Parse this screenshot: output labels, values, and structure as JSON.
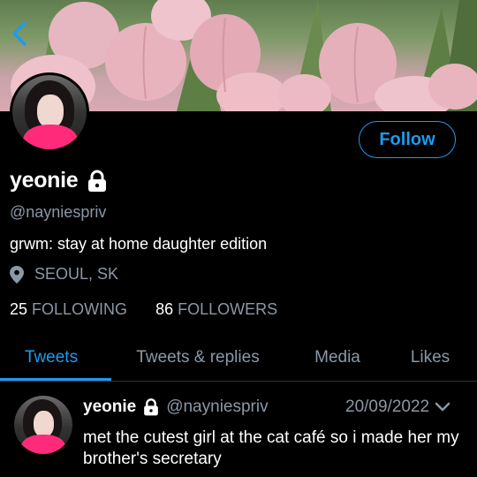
{
  "colors": {
    "accent": "#1d9bf0",
    "secondary_text": "#8b98a5",
    "background": "#000000"
  },
  "header": {
    "back_icon": "chevron-left-icon",
    "banner": "pink-tulips-photo"
  },
  "profile": {
    "follow_label": "Follow",
    "name": "yeonie",
    "handle": "@nayniespriv",
    "bio": "grwm: stay at home daughter edition",
    "location": "SEOUL, SK",
    "following_count": "25",
    "following_label": "FOLLOWING",
    "followers_count": "86",
    "followers_label": "FOLLOWERS"
  },
  "tabs": [
    {
      "label": "Tweets",
      "active": true
    },
    {
      "label": "Tweets & replies",
      "active": false
    },
    {
      "label": "Media",
      "active": false
    },
    {
      "label": "Likes",
      "active": false
    }
  ],
  "tweet": {
    "name": "yeonie",
    "handle": "@nayniespriv",
    "date": "20/09/2022",
    "text": "met the cutest girl at the cat café so i made her my brother's secretary"
  }
}
